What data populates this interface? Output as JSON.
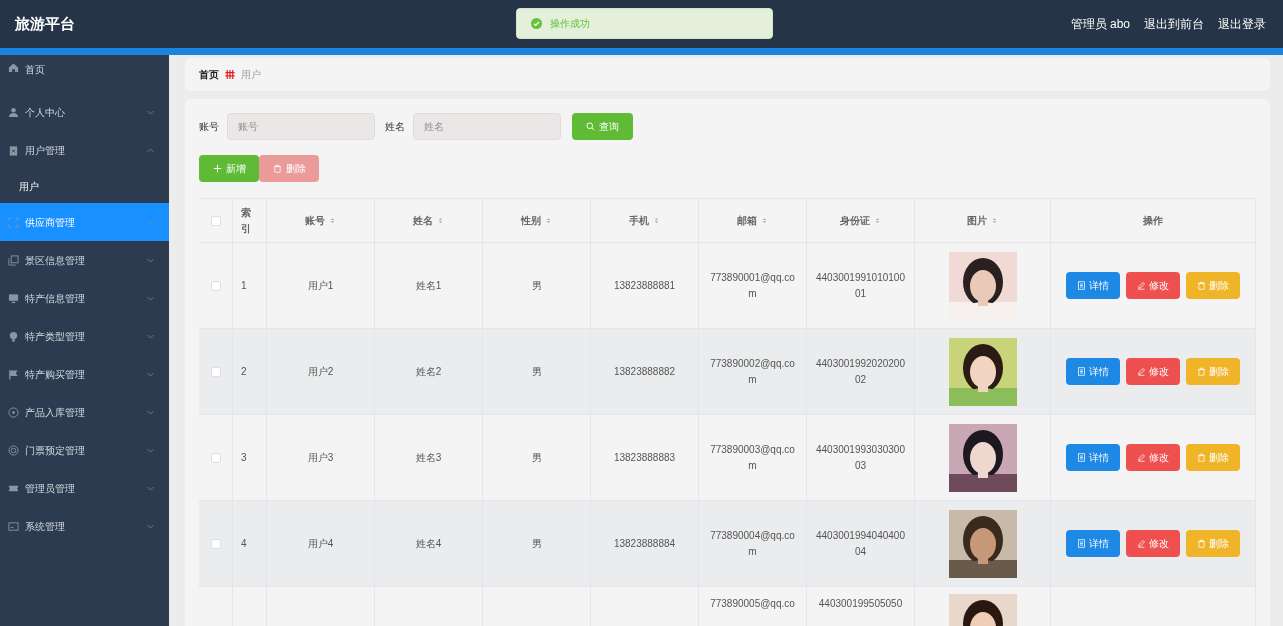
{
  "header": {
    "title": "旅游平台",
    "user": "管理员 abo",
    "links": [
      "退出到前台",
      "退出登录"
    ]
  },
  "toast": {
    "message": "操作成功"
  },
  "sidebar": {
    "items": [
      {
        "label": "首页",
        "selected": false
      },
      {
        "label": "个人中心",
        "selected": false,
        "expanded": false
      },
      {
        "label": "用户管理",
        "selected": false,
        "expanded": true,
        "children": [
          {
            "label": "用户",
            "selected": false
          }
        ]
      },
      {
        "label": "供应商管理",
        "selected": true,
        "expanded": false
      },
      {
        "label": "景区信息管理",
        "selected": false,
        "expanded": false
      },
      {
        "label": "特产信息管理",
        "selected": false,
        "expanded": false
      },
      {
        "label": "特产类型管理",
        "selected": false,
        "expanded": false
      },
      {
        "label": "特产购买管理",
        "selected": false,
        "expanded": false
      },
      {
        "label": "产品入库管理",
        "selected": false,
        "expanded": false
      },
      {
        "label": "门票预定管理",
        "selected": false,
        "expanded": false
      },
      {
        "label": "管理员管理",
        "selected": false,
        "expanded": false
      },
      {
        "label": "系统管理",
        "selected": false,
        "expanded": false
      }
    ]
  },
  "breadcrumb": [
    "首页",
    "用户"
  ],
  "search": {
    "fields": [
      {
        "label": "账号",
        "placeholder": "账号"
      },
      {
        "label": "姓名",
        "placeholder": "姓名"
      }
    ],
    "button": "查询"
  },
  "actions": [
    {
      "label": "新增",
      "kind": "add",
      "disabled": false
    },
    {
      "label": "删除",
      "kind": "delete",
      "disabled": true
    }
  ],
  "table": {
    "all_checked": false,
    "columns": [
      "索引",
      "账号",
      "姓名",
      "性别",
      "手机",
      "邮箱",
      "身份证",
      "图片",
      "操作"
    ],
    "rows": [
      {
        "checked": false,
        "index": "1",
        "account": "用户1",
        "name": "姓名1",
        "gender": "男",
        "phone": "13823888881",
        "email": "773890001@qq.com",
        "id_card": "440300199101010001",
        "buttons": [
          {
            "label": "详情",
            "kind": "detail"
          },
          {
            "label": "修改",
            "kind": "edit"
          },
          {
            "label": "删除",
            "kind": "delete"
          }
        ]
      },
      {
        "checked": false,
        "index": "2",
        "account": "用户2",
        "name": "姓名2",
        "gender": "男",
        "phone": "13823888882",
        "email": "773890002@qq.com",
        "id_card": "440300199202020002",
        "buttons": [
          {
            "label": "详情",
            "kind": "detail"
          },
          {
            "label": "修改",
            "kind": "edit"
          },
          {
            "label": "删除",
            "kind": "delete"
          }
        ]
      },
      {
        "checked": false,
        "index": "3",
        "account": "用户3",
        "name": "姓名3",
        "gender": "男",
        "phone": "13823888883",
        "email": "773890003@qq.com",
        "id_card": "440300199303030003",
        "buttons": [
          {
            "label": "详情",
            "kind": "detail"
          },
          {
            "label": "修改",
            "kind": "edit"
          },
          {
            "label": "删除",
            "kind": "delete"
          }
        ]
      },
      {
        "checked": false,
        "index": "4",
        "account": "用户4",
        "name": "姓名4",
        "gender": "男",
        "phone": "13823888884",
        "email": "773890004@qq.com",
        "id_card": "440300199404040004",
        "buttons": [
          {
            "label": "详情",
            "kind": "detail"
          },
          {
            "label": "修改",
            "kind": "edit"
          },
          {
            "label": "删除",
            "kind": "delete"
          }
        ]
      },
      {
        "email": "773890005@qq.co",
        "id_card": "440300199505050"
      }
    ]
  }
}
